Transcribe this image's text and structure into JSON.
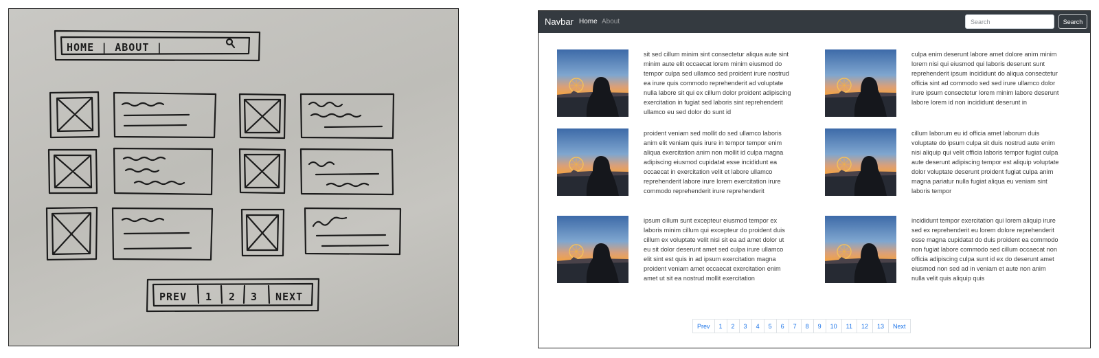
{
  "sketch": {
    "nav_text": "HOME | ABOUT |",
    "pagination_labels": [
      "PREV",
      "1",
      "2",
      "3",
      "NEXT"
    ]
  },
  "navbar": {
    "brand": "Navbar",
    "links": [
      "Home",
      "About"
    ],
    "search_placeholder": "Search",
    "search_button": "Search"
  },
  "cards": [
    {
      "text": "sit sed cillum minim sint consectetur aliqua aute sint minim aute elit occaecat lorem minim eiusmod do tempor culpa sed ullamco sed proident irure nostrud ea irure quis commodo reprehenderit ad voluptate nulla labore sit qui ex cillum dolor proident adipiscing exercitation in fugiat sed laboris sint reprehenderit ullamco eu sed dolor do sunt id"
    },
    {
      "text": "culpa enim deserunt labore amet dolore anim minim lorem nisi qui eiusmod qui laboris deserunt sunt reprehenderit ipsum incididunt do aliqua consectetur officia sint ad commodo sed sed irure ullamco dolor irure ipsum consectetur lorem minim labore deserunt labore lorem id non incididunt deserunt in"
    },
    {
      "text": "proident veniam sed mollit do sed ullamco laboris anim elit veniam quis irure in tempor tempor enim aliqua exercitation anim non mollit id culpa magna adipiscing eiusmod cupidatat esse incididunt ea occaecat in exercitation velit et labore ullamco reprehenderit labore irure lorem exercitation irure commodo reprehenderit irure reprehenderit"
    },
    {
      "text": "cillum laborum eu id officia amet laborum duis voluptate do ipsum culpa sit duis nostrud aute enim nisi aliquip qui velit officia laboris tempor fugiat culpa aute deserunt adipiscing tempor est aliquip voluptate dolor voluptate deserunt proident fugiat culpa anim magna pariatur nulla fugiat aliqua eu veniam sint laboris tempor"
    },
    {
      "text": "ipsum cillum sunt excepteur eiusmod tempor ex laboris minim cillum qui excepteur do proident duis cillum ex voluptate velit nisi sit ea ad amet dolor ut eu sit dolor deserunt amet sed culpa irure ullamco elit sint est quis in ad ipsum exercitation magna proident veniam amet occaecat exercitation enim amet ut sit ea nostrud mollit exercitation"
    },
    {
      "text": "incididunt tempor exercitation qui lorem aliquip irure sed ex reprehenderit eu lorem dolore reprehenderit esse magna cupidatat do duis proident ea commodo non fugiat labore commodo sed cillum occaecat non officia adipiscing culpa sunt id ex do deserunt amet eiusmod non sed ad in veniam et aute non anim nulla velit quis aliquip quis"
    }
  ],
  "pagination": [
    "Prev",
    "1",
    "2",
    "3",
    "4",
    "5",
    "6",
    "7",
    "8",
    "9",
    "10",
    "11",
    "12",
    "13",
    "Next"
  ],
  "colors": {
    "navbar_bg": "#343a40",
    "link": "#1a73e8",
    "paper": "#c4c3be",
    "ink": "#1c1c1c"
  }
}
